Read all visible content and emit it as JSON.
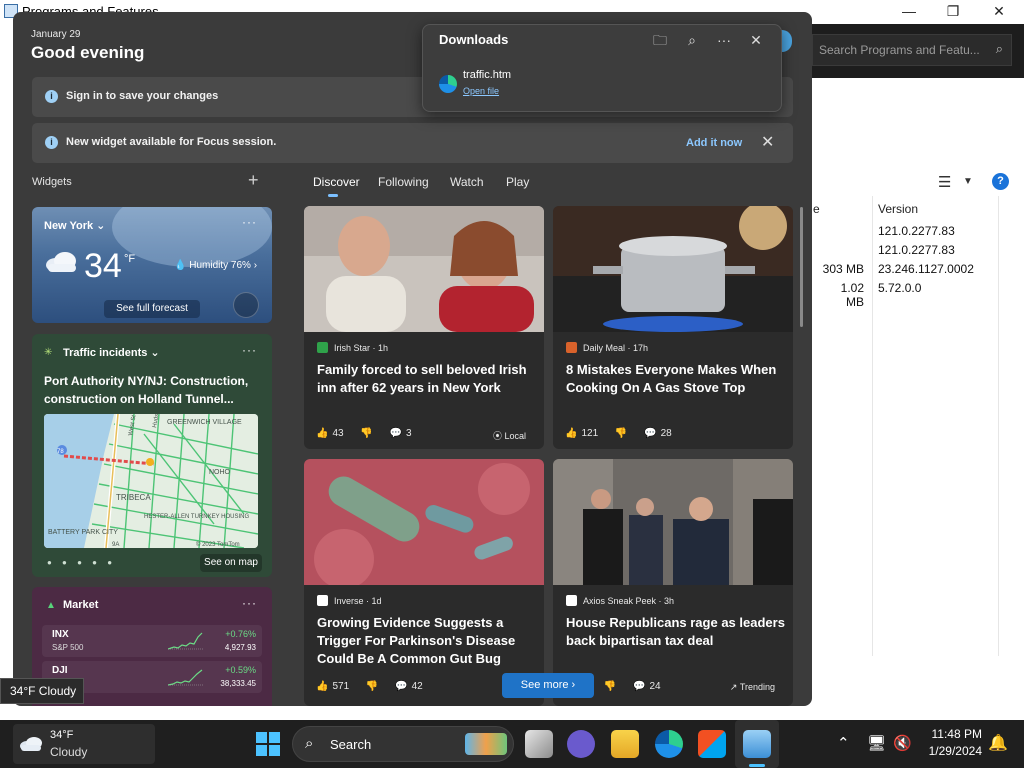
{
  "background_window": {
    "title": "Programs and Features",
    "search_placeholder": "Search Programs and Featu...",
    "columns": [
      "e",
      "Version"
    ],
    "rows": [
      {
        "size": "",
        "version": "121.0.2277.83"
      },
      {
        "size": "",
        "version": "121.0.2277.83"
      },
      {
        "size": "303 MB",
        "version": "23.246.1127.0002"
      },
      {
        "size": "1.02 MB",
        "version": "5.72.0.0"
      }
    ]
  },
  "widgets": {
    "date": "January 29",
    "greeting": "Good evening",
    "banners": [
      {
        "text": "Sign in to save your changes"
      },
      {
        "text": "New widget available for Focus session.",
        "action": "Add it now"
      }
    ],
    "section_label": "Widgets",
    "add_label": "+",
    "tabs": [
      "Discover",
      "Following",
      "Watch",
      "Play"
    ],
    "weather": {
      "city": "New York",
      "temp": "34",
      "unit": "°F",
      "humidity": "Humidity 76%",
      "forecast_button": "See full forecast"
    },
    "traffic": {
      "label": "Traffic incidents",
      "headline": "Port Authority NY/NJ: Construction, construction on Holland Tunnel...",
      "map_labels": [
        "GREENWICH VILLAGE",
        "NOHO",
        "TRIBECA",
        "HESTER-ALLEN TURNKEY HOUSING",
        "BATTERY PARK CITY",
        "West St",
        "Hudson St",
        "78",
        "9A",
        "© 2023 TomTom"
      ],
      "button": "See on map"
    },
    "market": {
      "label": "Market",
      "rows": [
        {
          "name": "INX",
          "sub": "S&P 500",
          "change": "+0.76%",
          "value": "4,927.93"
        },
        {
          "name": "DJI",
          "sub": "",
          "change": "+0.59%",
          "value": "38,333.45"
        }
      ]
    },
    "news": [
      {
        "source": "Irish Star · 1h",
        "title": "Family forced to sell beloved Irish inn after 62 years in New York",
        "likes": "43",
        "comments": "3",
        "tag": "Local",
        "logo_color": "#2fa24a"
      },
      {
        "source": "Daily Meal · 17h",
        "title": "8 Mistakes Everyone Makes When Cooking On A Gas Stove Top",
        "likes": "121",
        "comments": "28",
        "tag": "",
        "logo_color": "#d9622b"
      },
      {
        "source": "Inverse · 1d",
        "title": "Growing Evidence Suggests a Trigger For Parkinson's Disease Could Be A Common Gut Bug",
        "likes": "571",
        "comments": "42",
        "tag": "",
        "logo_color": "#ffffff"
      },
      {
        "source": "Axios Sneak Peek · 3h",
        "title": "House Republicans rage as leaders back bipartisan tax deal",
        "likes": "2",
        "comments": "24",
        "tag": "Trending",
        "logo_color": "#ffffff"
      }
    ],
    "see_more": "See more"
  },
  "downloads": {
    "title": "Downloads",
    "file": "traffic.htm",
    "open_label": "Open file"
  },
  "tooltip": "34°F Cloudy",
  "taskbar": {
    "weather_temp": "34°F",
    "weather_cond": "Cloudy",
    "search_label": "Search",
    "time": "11:48 PM",
    "date": "1/29/2024"
  }
}
